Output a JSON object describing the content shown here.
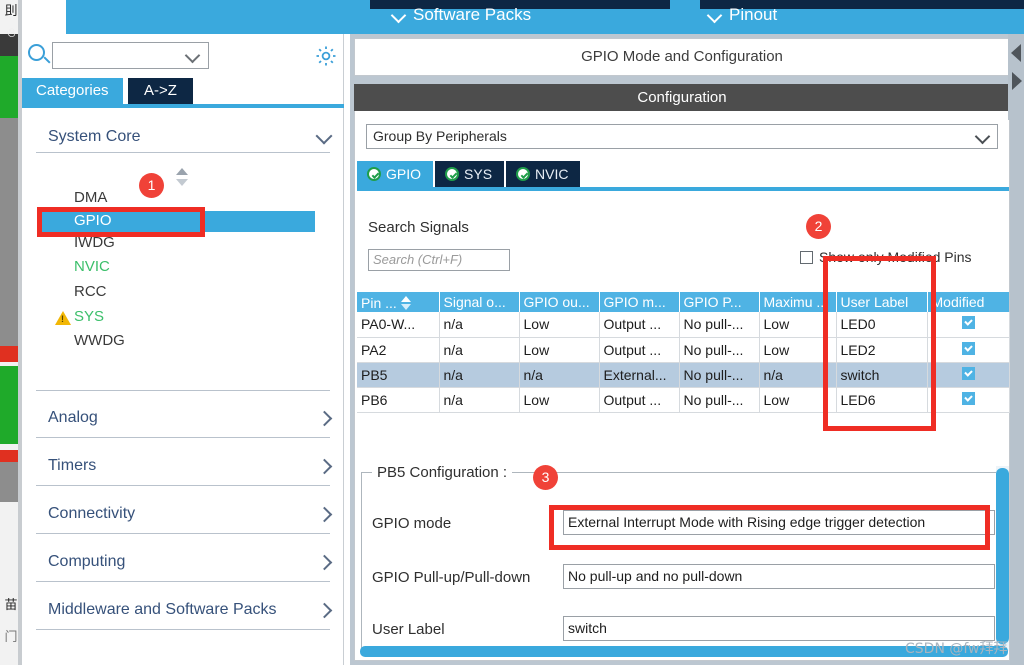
{
  "window": {
    "top_tabs": [
      {
        "label": "Software Packs",
        "icon": "chevron-down-icon"
      },
      {
        "label": "Pinout",
        "icon": "chevron-down-icon"
      }
    ]
  },
  "background_window": {
    "glyphs": [
      "刞",
      "ও",
      "苗",
      "门"
    ]
  },
  "sidebar": {
    "search": {
      "value": "",
      "placeholder": ""
    },
    "settings_icon": "gear-icon",
    "search_icon": "search-icon",
    "tabs": [
      {
        "label": "Categories",
        "active": true
      },
      {
        "label": "A->Z",
        "active": false
      }
    ],
    "groups": [
      {
        "label": "System Core",
        "expanded": true,
        "icon": "chevron-down-icon"
      },
      {
        "label": "Analog",
        "expanded": false,
        "icon": "chevron-right-icon"
      },
      {
        "label": "Timers",
        "expanded": false,
        "icon": "chevron-right-icon"
      },
      {
        "label": "Connectivity",
        "expanded": false,
        "icon": "chevron-right-icon"
      },
      {
        "label": "Computing",
        "expanded": false,
        "icon": "chevron-right-icon"
      },
      {
        "label": "Middleware and Software Packs",
        "expanded": false,
        "icon": "chevron-right-icon"
      }
    ],
    "peripherals": [
      {
        "label": "DMA",
        "state": "normal"
      },
      {
        "label": "GPIO",
        "state": "selected"
      },
      {
        "label": "IWDG",
        "state": "normal"
      },
      {
        "label": "NVIC",
        "state": "configured"
      },
      {
        "label": "RCC",
        "state": "normal"
      },
      {
        "label": "SYS",
        "state": "configured",
        "warning": true
      },
      {
        "label": "WWDG",
        "state": "normal"
      }
    ]
  },
  "main": {
    "mode_header": "GPIO Mode and Configuration",
    "configuration_header": "Configuration",
    "group_by": {
      "value": "Group By Peripherals",
      "icon": "chevron-down-icon"
    },
    "peripheral_tabs": [
      {
        "label": "GPIO",
        "active": true,
        "status_icon": "check-circle-icon"
      },
      {
        "label": "SYS",
        "active": false,
        "status_icon": "check-circle-icon"
      },
      {
        "label": "NVIC",
        "active": false,
        "status_icon": "check-circle-icon"
      }
    ],
    "search_signals": {
      "label": "Search Signals",
      "placeholder": "Search (Ctrl+F)",
      "value": ""
    },
    "show_modified": {
      "label": "Show only Modified Pins",
      "checked": false
    },
    "table": {
      "columns": [
        "Pin ...",
        "Signal o...",
        "GPIO ou...",
        "GPIO m...",
        "GPIO P...",
        "Maximu ..",
        "User Label",
        "Modified"
      ],
      "sort_column": 0,
      "rows": [
        {
          "selected": false,
          "cells": [
            "PA0-W...",
            "n/a",
            "Low",
            "Output ...",
            "No pull-...",
            "Low",
            "LED0"
          ],
          "modified": true
        },
        {
          "selected": false,
          "cells": [
            "PA2",
            "n/a",
            "Low",
            "Output ...",
            "No pull-...",
            "Low",
            "LED2"
          ],
          "modified": true
        },
        {
          "selected": true,
          "cells": [
            "PB5",
            "n/a",
            "n/a",
            "External...",
            "No pull-...",
            "n/a",
            "switch"
          ],
          "modified": true
        },
        {
          "selected": false,
          "cells": [
            "PB6",
            "n/a",
            "Low",
            "Output ...",
            "No pull-...",
            "Low",
            "LED6"
          ],
          "modified": true
        }
      ]
    },
    "pin_config": {
      "title": "PB5 Configuration :",
      "fields": [
        {
          "label": "GPIO mode",
          "value": "External Interrupt Mode with Rising edge trigger detection"
        },
        {
          "label": "GPIO Pull-up/Pull-down",
          "value": "No pull-up and no pull-down"
        },
        {
          "label": "User Label",
          "value": "switch"
        }
      ]
    }
  },
  "annotations": {
    "badges": [
      "1",
      "2",
      "3"
    ],
    "accent_red": "#ef2d24",
    "accent_blue": "#3aa9dd",
    "navy": "#0d2744",
    "table_header_blue": "#4fb3e4"
  },
  "watermark": "CSDN @fw拜拜"
}
